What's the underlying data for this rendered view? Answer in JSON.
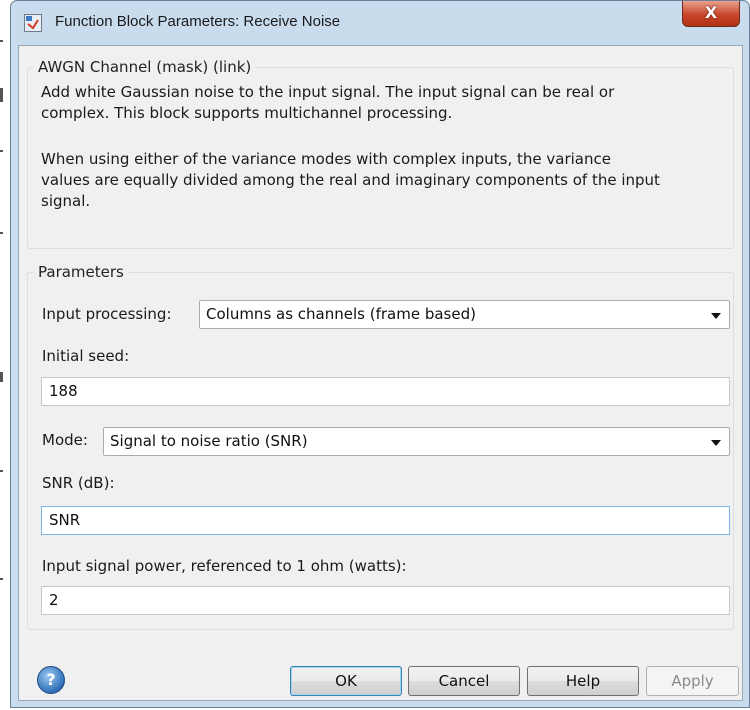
{
  "window": {
    "title": "Function Block Parameters: Receive Noise",
    "close_label": "X"
  },
  "description_group": {
    "title": "AWGN Channel (mask) (link)",
    "para1_line1": "Add white Gaussian noise to the input signal. The input signal can be real or",
    "para1_line2": "complex. This block supports multichannel processing.",
    "para2_line1": "When using either of the variance modes with complex inputs, the variance",
    "para2_line2": "values are equally divided among the real and imaginary components of the input",
    "para2_line3": "signal."
  },
  "parameters": {
    "title": "Parameters",
    "input_processing_label": "Input processing:",
    "input_processing_value": "Columns as channels (frame based)",
    "initial_seed_label": "Initial seed:",
    "initial_seed_value": "188",
    "mode_label": "Mode:",
    "mode_value": "Signal to noise ratio  (SNR)",
    "snr_label": "SNR (dB):",
    "snr_value": "SNR",
    "input_power_label": "Input signal power, referenced to 1 ohm (watts):",
    "input_power_value": "2"
  },
  "buttons": {
    "help_icon_glyph": "?",
    "ok": "OK",
    "cancel": "Cancel",
    "help": "Help",
    "apply": "Apply"
  },
  "colors": {
    "title_bar": "#c9dcee",
    "close_button": "#c7462b",
    "dialog_background": "#f0f0f0",
    "focused_border": "#7eb4ea"
  }
}
